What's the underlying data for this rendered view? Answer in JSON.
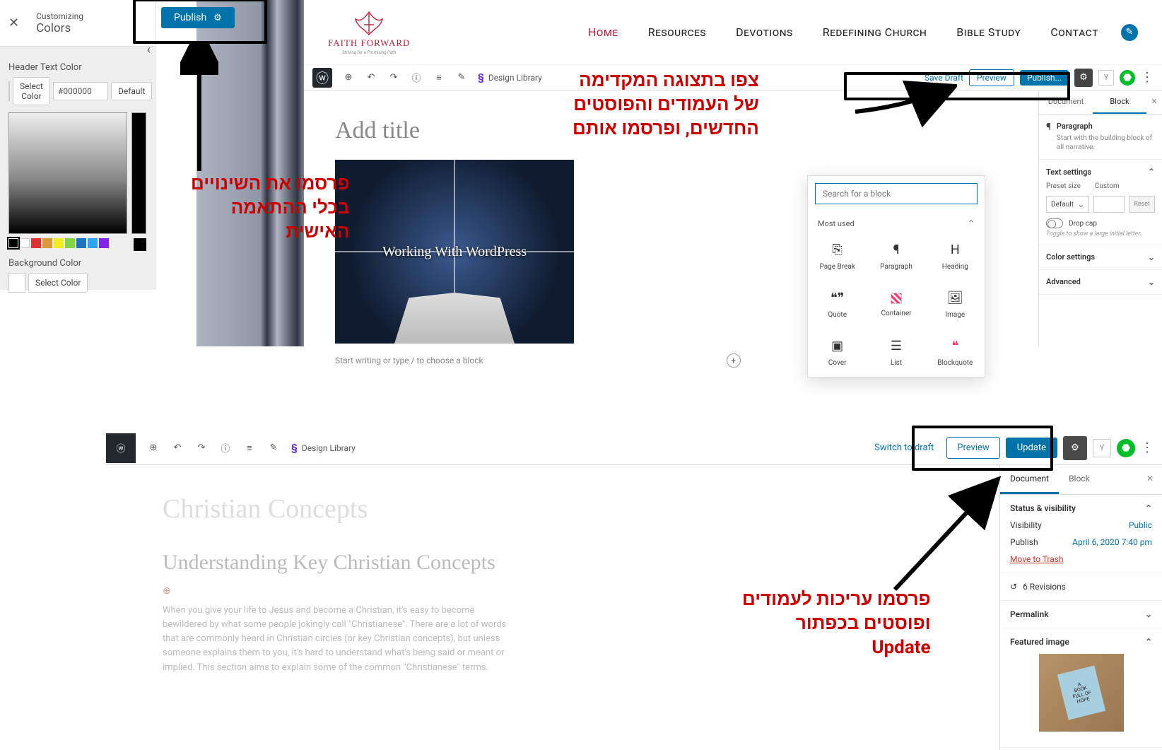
{
  "customizer": {
    "customizing": "Customizing",
    "section": "Colors",
    "publish": "Publish",
    "header_text_color": "Header Text Color",
    "select_color": "Select Color",
    "hex": "#000000",
    "default": "Default",
    "background_color": "Background Color",
    "palette": [
      "#000000",
      "#ffffff",
      "#dd3333",
      "#dd9933",
      "#eeee22",
      "#81d742",
      "#1e73be",
      "#8224e3"
    ]
  },
  "annotations": {
    "a1": "פרסמו את השינויים\nבכלי ההתאמה\nהאישית",
    "a2": "צפו בתצוגה המקדימה\nשל העמודים והפוסטים\nהחדשים, ופרסמו אותם",
    "a3": "פרסמו עריכות לעמודים\nופוסטים בכפתור\nUpdate"
  },
  "site": {
    "brand1": "FAITH FORWARD",
    "brand2": "Striving for a Promising Path",
    "nav": [
      "Home",
      "Resources",
      "Devotions",
      "Redefining Church",
      "Bible Study",
      "Contact"
    ]
  },
  "editor1": {
    "design_library": "Design Library",
    "save_draft": "Save Draft",
    "preview": "Preview",
    "publish": "Publish...",
    "add_title": "Add title",
    "hero": "Working With WordPress",
    "start_writing": "Start writing or type / to choose a block",
    "search_ph": "Search for a block",
    "most_used": "Most used",
    "blocks": [
      "Page Break",
      "Paragraph",
      "Heading",
      "Quote",
      "Container",
      "Image",
      "Cover",
      "List",
      "Blockquote"
    ],
    "sidebar": {
      "tab_document": "Document",
      "tab_block": "Block",
      "paragraph": "Paragraph",
      "para_desc": "Start with the building block of all narrative.",
      "text_settings": "Text settings",
      "preset_size": "Preset size",
      "default": "Default",
      "custom": "Custom",
      "reset": "Reset",
      "drop_cap": "Drop cap",
      "drop_hint": "Toggle to show a large initial letter.",
      "color_settings": "Color settings",
      "advanced": "Advanced"
    }
  },
  "editor2": {
    "design_library": "Design Library",
    "switch_draft": "Switch to draft",
    "preview": "Preview",
    "update": "Update",
    "title": "Christian Concepts",
    "subtitle": "Understanding Key Christian Concepts",
    "body": "When you give your life to Jesus and become a Christian, it's easy to become bewildered by what some people jokingly call \"Christianese\". There are a lot of words that are commonly heard in Christian circles (or key Christian concepts), but unless someone explains them to you, it's hard to understand what's being said or meant or implied. This section aims to explain some of the common \"Christianese\" terms.",
    "sidebar": {
      "tab_document": "Document",
      "tab_block": "Block",
      "status": "Status & visibility",
      "visibility": "Visibility",
      "visibility_val": "Public",
      "publish": "Publish",
      "publish_val": "April 6, 2020 7:40 pm",
      "trash": "Move to Trash",
      "revisions": "6 Revisions",
      "permalink": "Permalink",
      "featured": "Featured image",
      "book_text": "A\nBOOK\nFULL OF\nHOPE"
    }
  }
}
